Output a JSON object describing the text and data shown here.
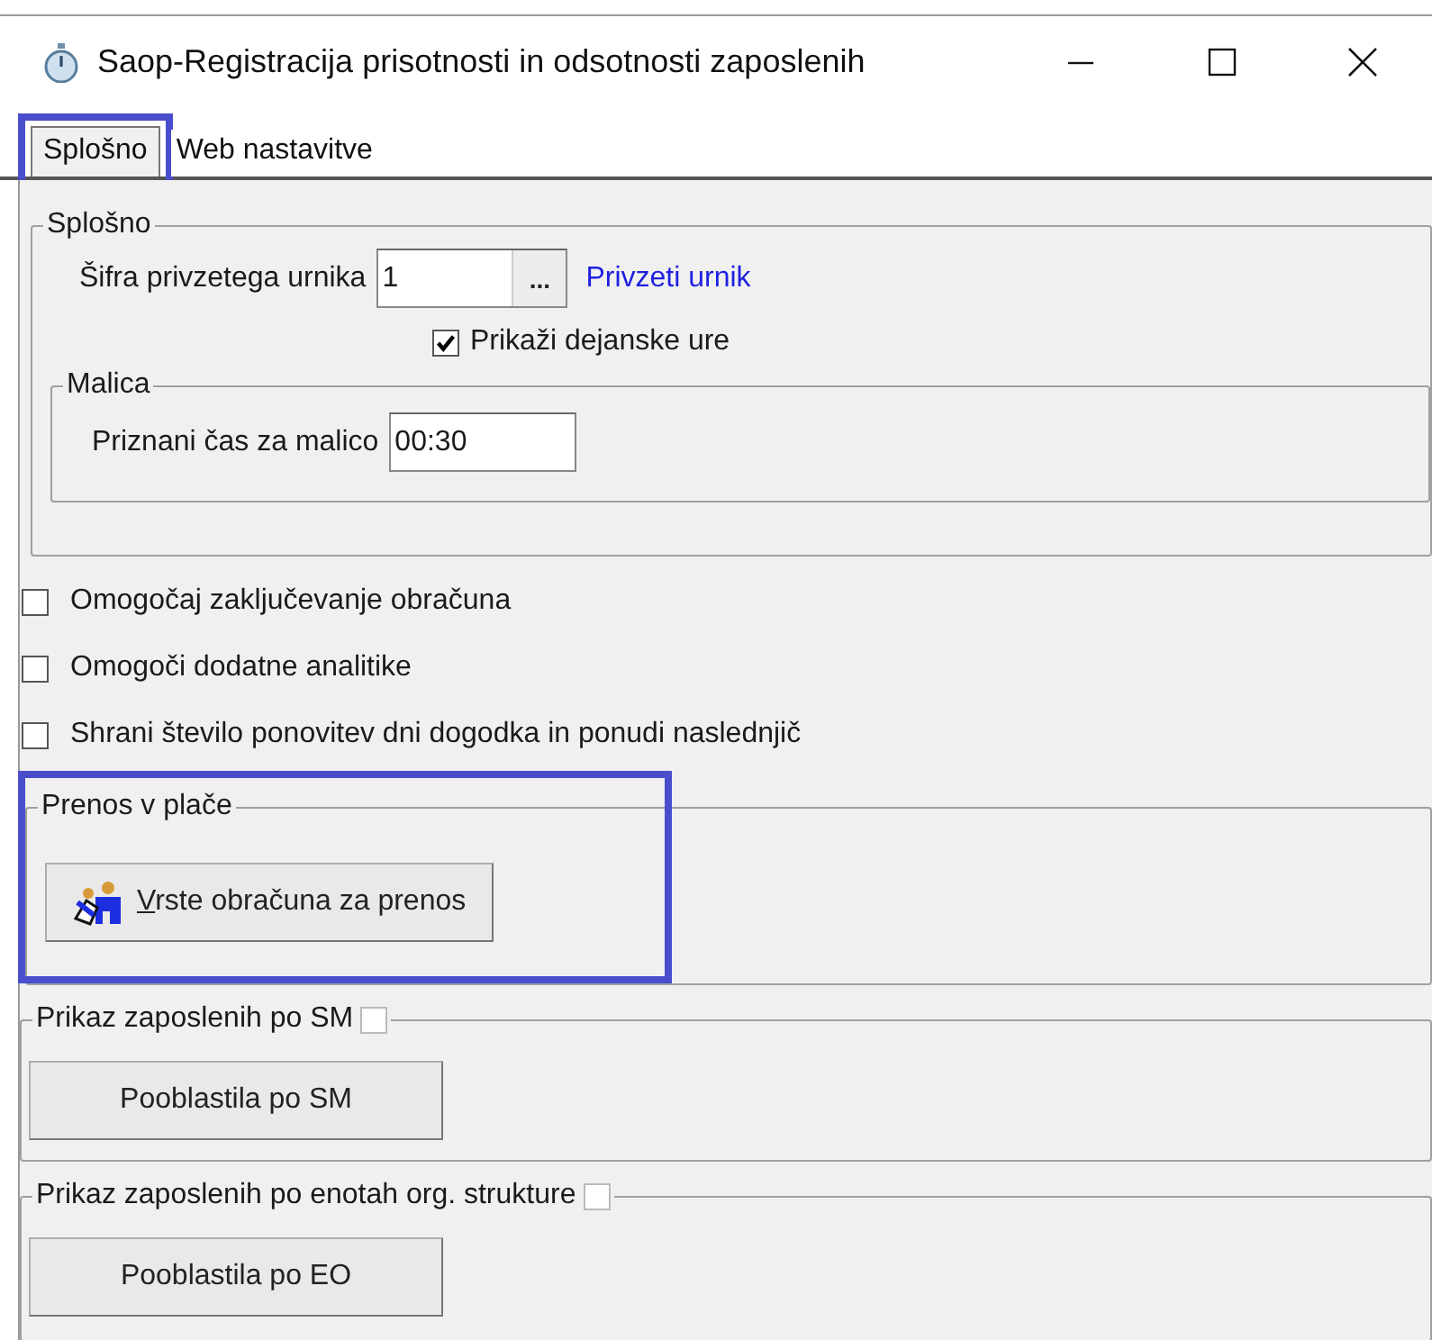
{
  "window": {
    "title": "Saop-Registracija prisotnosti in odsotnosti zaposlenih"
  },
  "tabs": [
    {
      "label": "Splošno",
      "selected": true,
      "highlighted": true
    },
    {
      "label": "Web nastavitve",
      "selected": false,
      "highlighted": false
    }
  ],
  "general": {
    "title": "Splošno",
    "schedule": {
      "label": "Šifra privzetega urnika",
      "value": "1",
      "browse": "...",
      "link": "Privzeti urnik"
    },
    "show_actual": {
      "label": "Prikaži dejanske ure",
      "checked": true
    },
    "lunch": {
      "title": "Malica",
      "label": "Priznani čas za malico",
      "value": "00:30"
    }
  },
  "options": [
    {
      "label": "Omogočaj zaključevanje obračuna",
      "checked": false
    },
    {
      "label": "Omogoči dodatne analitike",
      "checked": false
    },
    {
      "label": "Shrani število ponovitev dni dogodka in ponudi naslednjič",
      "checked": false
    }
  ],
  "transfer": {
    "title": "Prenos v plače",
    "highlighted": true,
    "button": "Vrste obračuna za prenos"
  },
  "sections": [
    {
      "title": "Prikaz zaposlenih po SM",
      "checked": false,
      "button": "Pooblastila po SM"
    },
    {
      "title": "Prikaz zaposlenih po enotah org. strukture",
      "checked": false,
      "button": "Pooblastila po EO"
    }
  ]
}
